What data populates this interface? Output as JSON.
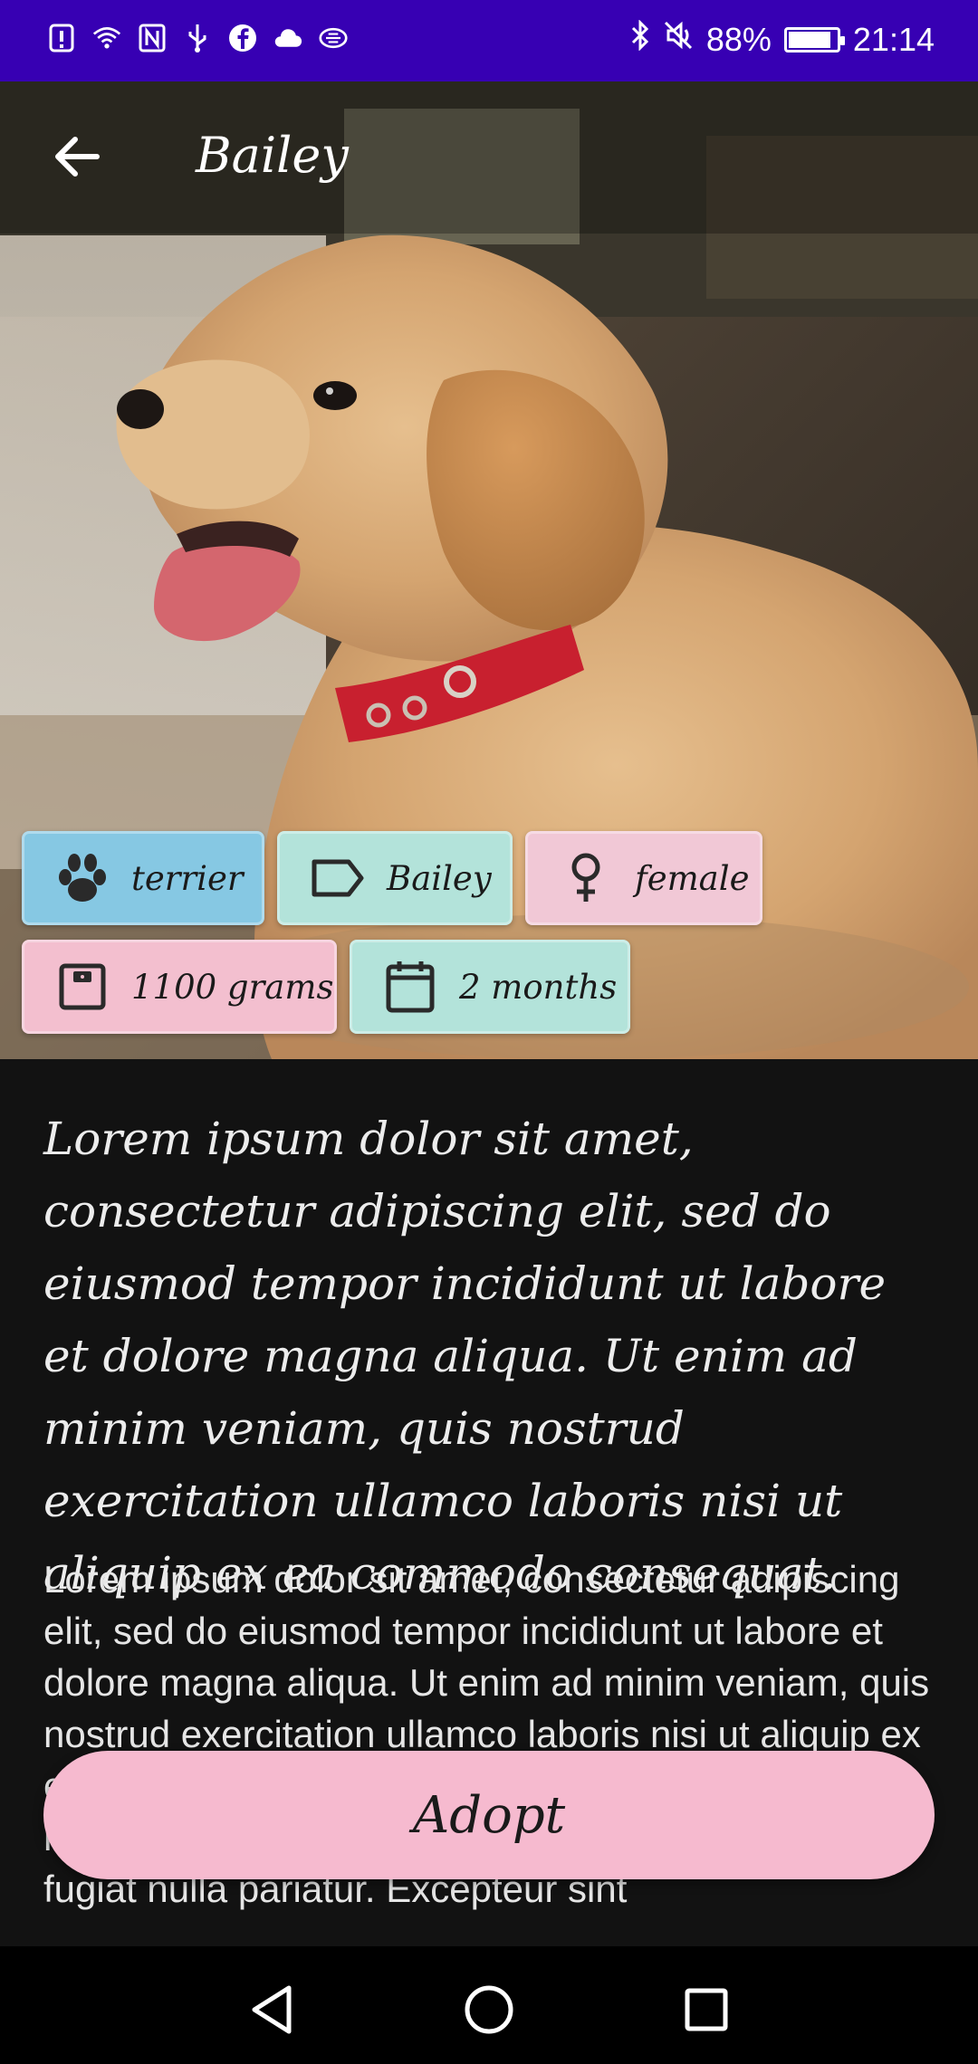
{
  "status_bar": {
    "battery_percent": "88%",
    "battery_level": 0.88,
    "time": "21:14",
    "left_icons": [
      "alert-icon",
      "wifi-icon",
      "nfc-icon",
      "usb-icon",
      "facebook-icon",
      "cloud-icon",
      "message-icon"
    ],
    "right_icons": [
      "bluetooth-icon",
      "mute-icon",
      "battery-icon"
    ]
  },
  "appbar": {
    "title": "Bailey",
    "back_icon": "arrow-left-icon"
  },
  "chips": {
    "breed": {
      "label": "terrier",
      "icon": "paw-icon",
      "color": "#86c8e3"
    },
    "name": {
      "label": "Bailey",
      "icon": "tag-icon",
      "color": "#b3e3da"
    },
    "gender": {
      "label": "female",
      "icon": "female-icon",
      "color": "#f1c8d6"
    },
    "weight": {
      "label": "1100 grams",
      "icon": "scale-icon",
      "color": "#f3bfcf"
    },
    "age": {
      "label": "2 months",
      "icon": "calendar-icon",
      "color": "#b3e3da"
    }
  },
  "description": {
    "title": "Lorem ipsum dolor sit amet, consectetur adipiscing elit, sed do eiusmod tempor incididunt ut labore et dolore magna aliqua. Ut enim ad minim veniam, quis nostrud exercitation ullamco laboris nisi ut aliquip ex ea commodo consequat.",
    "body": "Lorem ipsum dolor sit amet, consectetur adipiscing elit, sed do eiusmod tempor incididunt ut labore et dolore magna aliqua. Ut enim ad minim veniam, quis nostrud exercitation ullamco laboris nisi ut aliquip ex ea commodo consequat. Duis aute irure dolor in reprehenderit in voluptate velit esse cillum dolore eu fugiat nulla pariatur. Excepteur sint"
  },
  "actions": {
    "adopt_label": "Adopt"
  },
  "navigation": {
    "icons": [
      "back-triangle-icon",
      "home-circle-icon",
      "recents-square-icon"
    ]
  },
  "colors": {
    "status_bar": "#3700b3",
    "background": "#121212",
    "adopt_button": "#f6bacf"
  }
}
